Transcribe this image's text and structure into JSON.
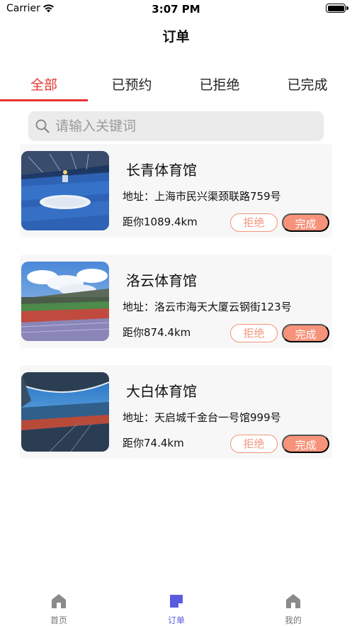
{
  "status_bar": {
    "carrier": "Carrier",
    "time": "3:07 PM",
    "battery_level": 1.0
  },
  "nav": {
    "title": "订单"
  },
  "tabs": [
    {
      "label": "全部",
      "active": true
    },
    {
      "label": "已预约",
      "active": false
    },
    {
      "label": "已拒绝",
      "active": false
    },
    {
      "label": "已完成",
      "active": false
    }
  ],
  "search": {
    "placeholder": "请输入关键词",
    "value": "",
    "icon": "search-icon"
  },
  "orders": [
    {
      "name": "长青体育馆",
      "address": "地址：上海市民兴渠颈联路759号",
      "distance": "距你1089.4km",
      "reject_label": "拒绝",
      "complete_label": "完成"
    },
    {
      "name": "洛云体育馆",
      "address": "地址：洛云市海天大厦云钢街123号",
      "distance": "距你874.4km",
      "reject_label": "拒绝",
      "complete_label": "完成"
    },
    {
      "name": "大白体育馆",
      "address": "地址：天启城千金台一号馆999号",
      "distance": "距你74.4km",
      "reject_label": "拒绝",
      "complete_label": "完成"
    }
  ],
  "tabbar": [
    {
      "label": "首页",
      "icon": "home-icon",
      "active": false
    },
    {
      "label": "订单",
      "icon": "order-icon",
      "active": true
    },
    {
      "label": "我的",
      "icon": "profile-icon",
      "active": false
    }
  ],
  "colors": {
    "accent_red": "#e8332f",
    "button_orange": "#f6937a",
    "tabbar_active": "#5b5be0",
    "tabbar_inactive": "#8a8a8a"
  }
}
